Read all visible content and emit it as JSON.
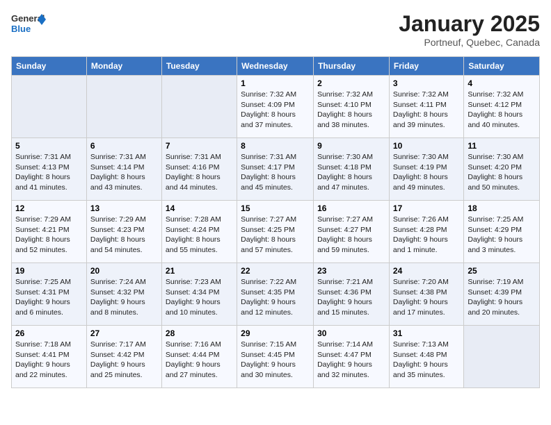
{
  "logo": {
    "line1": "General",
    "line2": "Blue"
  },
  "title": "January 2025",
  "location": "Portneuf, Quebec, Canada",
  "weekdays": [
    "Sunday",
    "Monday",
    "Tuesday",
    "Wednesday",
    "Thursday",
    "Friday",
    "Saturday"
  ],
  "weeks": [
    [
      {
        "day": "",
        "info": ""
      },
      {
        "day": "",
        "info": ""
      },
      {
        "day": "",
        "info": ""
      },
      {
        "day": "1",
        "info": "Sunrise: 7:32 AM\nSunset: 4:09 PM\nDaylight: 8 hours and 37 minutes."
      },
      {
        "day": "2",
        "info": "Sunrise: 7:32 AM\nSunset: 4:10 PM\nDaylight: 8 hours and 38 minutes."
      },
      {
        "day": "3",
        "info": "Sunrise: 7:32 AM\nSunset: 4:11 PM\nDaylight: 8 hours and 39 minutes."
      },
      {
        "day": "4",
        "info": "Sunrise: 7:32 AM\nSunset: 4:12 PM\nDaylight: 8 hours and 40 minutes."
      }
    ],
    [
      {
        "day": "5",
        "info": "Sunrise: 7:31 AM\nSunset: 4:13 PM\nDaylight: 8 hours and 41 minutes."
      },
      {
        "day": "6",
        "info": "Sunrise: 7:31 AM\nSunset: 4:14 PM\nDaylight: 8 hours and 43 minutes."
      },
      {
        "day": "7",
        "info": "Sunrise: 7:31 AM\nSunset: 4:16 PM\nDaylight: 8 hours and 44 minutes."
      },
      {
        "day": "8",
        "info": "Sunrise: 7:31 AM\nSunset: 4:17 PM\nDaylight: 8 hours and 45 minutes."
      },
      {
        "day": "9",
        "info": "Sunrise: 7:30 AM\nSunset: 4:18 PM\nDaylight: 8 hours and 47 minutes."
      },
      {
        "day": "10",
        "info": "Sunrise: 7:30 AM\nSunset: 4:19 PM\nDaylight: 8 hours and 49 minutes."
      },
      {
        "day": "11",
        "info": "Sunrise: 7:30 AM\nSunset: 4:20 PM\nDaylight: 8 hours and 50 minutes."
      }
    ],
    [
      {
        "day": "12",
        "info": "Sunrise: 7:29 AM\nSunset: 4:21 PM\nDaylight: 8 hours and 52 minutes."
      },
      {
        "day": "13",
        "info": "Sunrise: 7:29 AM\nSunset: 4:23 PM\nDaylight: 8 hours and 54 minutes."
      },
      {
        "day": "14",
        "info": "Sunrise: 7:28 AM\nSunset: 4:24 PM\nDaylight: 8 hours and 55 minutes."
      },
      {
        "day": "15",
        "info": "Sunrise: 7:27 AM\nSunset: 4:25 PM\nDaylight: 8 hours and 57 minutes."
      },
      {
        "day": "16",
        "info": "Sunrise: 7:27 AM\nSunset: 4:27 PM\nDaylight: 8 hours and 59 minutes."
      },
      {
        "day": "17",
        "info": "Sunrise: 7:26 AM\nSunset: 4:28 PM\nDaylight: 9 hours and 1 minute."
      },
      {
        "day": "18",
        "info": "Sunrise: 7:25 AM\nSunset: 4:29 PM\nDaylight: 9 hours and 3 minutes."
      }
    ],
    [
      {
        "day": "19",
        "info": "Sunrise: 7:25 AM\nSunset: 4:31 PM\nDaylight: 9 hours and 6 minutes."
      },
      {
        "day": "20",
        "info": "Sunrise: 7:24 AM\nSunset: 4:32 PM\nDaylight: 9 hours and 8 minutes."
      },
      {
        "day": "21",
        "info": "Sunrise: 7:23 AM\nSunset: 4:34 PM\nDaylight: 9 hours and 10 minutes."
      },
      {
        "day": "22",
        "info": "Sunrise: 7:22 AM\nSunset: 4:35 PM\nDaylight: 9 hours and 12 minutes."
      },
      {
        "day": "23",
        "info": "Sunrise: 7:21 AM\nSunset: 4:36 PM\nDaylight: 9 hours and 15 minutes."
      },
      {
        "day": "24",
        "info": "Sunrise: 7:20 AM\nSunset: 4:38 PM\nDaylight: 9 hours and 17 minutes."
      },
      {
        "day": "25",
        "info": "Sunrise: 7:19 AM\nSunset: 4:39 PM\nDaylight: 9 hours and 20 minutes."
      }
    ],
    [
      {
        "day": "26",
        "info": "Sunrise: 7:18 AM\nSunset: 4:41 PM\nDaylight: 9 hours and 22 minutes."
      },
      {
        "day": "27",
        "info": "Sunrise: 7:17 AM\nSunset: 4:42 PM\nDaylight: 9 hours and 25 minutes."
      },
      {
        "day": "28",
        "info": "Sunrise: 7:16 AM\nSunset: 4:44 PM\nDaylight: 9 hours and 27 minutes."
      },
      {
        "day": "29",
        "info": "Sunrise: 7:15 AM\nSunset: 4:45 PM\nDaylight: 9 hours and 30 minutes."
      },
      {
        "day": "30",
        "info": "Sunrise: 7:14 AM\nSunset: 4:47 PM\nDaylight: 9 hours and 32 minutes."
      },
      {
        "day": "31",
        "info": "Sunrise: 7:13 AM\nSunset: 4:48 PM\nDaylight: 9 hours and 35 minutes."
      },
      {
        "day": "",
        "info": ""
      }
    ]
  ]
}
